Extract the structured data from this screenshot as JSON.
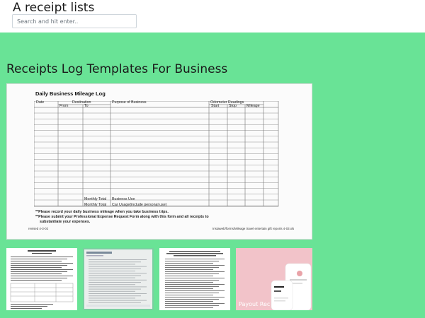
{
  "header": {
    "site_title": "A receipt lists",
    "search_placeholder": "Search and hit enter.."
  },
  "main": {
    "section_title": "Receipts Log Templates For Business",
    "hero_document": {
      "title": "Daily Business Mileage Log",
      "columns": {
        "date": "Date",
        "destination": "Destination",
        "from": "From",
        "to": "To",
        "purpose": "Purpose of Business",
        "odometer": "Odometer Readings",
        "start": "Start",
        "stop": "Stop",
        "mileage": "Mileage"
      },
      "monthly_total_1": "Monthly Total",
      "monthly_total_2": "Monthly Total",
      "business_use": "Business Use",
      "car_usage": "Car Usage(include personal use)",
      "note_1": "**Please record your daily business mileage when you take business trips.",
      "note_2": "**Please submit your Professional Expense Request Form along with this form and all receipts to",
      "note_3": "substantiate your expenses.",
      "revised": "revised 4-3-02",
      "footer_path": "Instaweb/forms/Mileage travel entertain gift reports 4-03.xls"
    },
    "thumbnails": [
      {
        "name": "receipt-form-thumbnail"
      },
      {
        "name": "payment-receipt-thumbnail"
      },
      {
        "name": "expense-reimbursement-thumbnail"
      },
      {
        "name": "payout-receipt-thumbnail",
        "caption": "Payout Rec"
      }
    ]
  }
}
